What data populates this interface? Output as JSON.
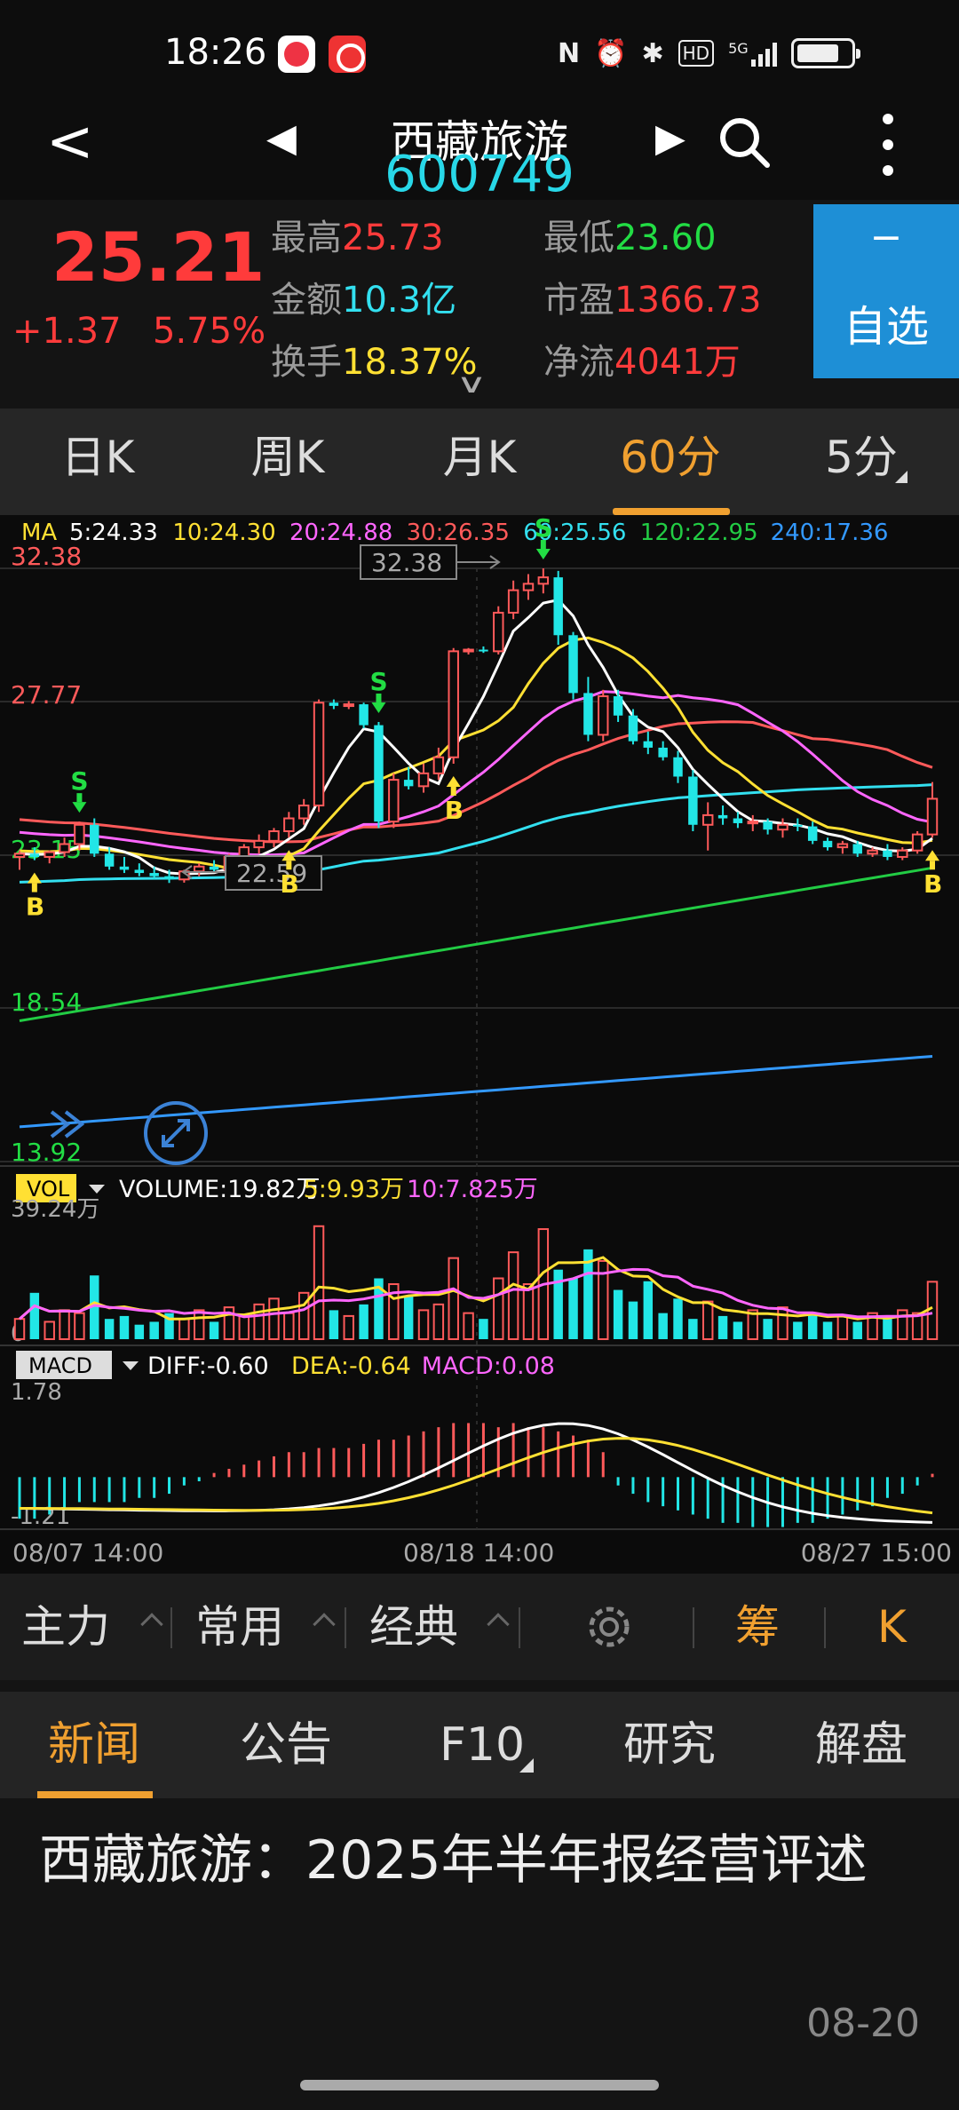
{
  "status": {
    "time": "18:26",
    "icons": [
      "nfc-icon",
      "alarm-icon",
      "bluetooth-icon",
      "hd-icon",
      "5g-signal-icon",
      "battery-icon"
    ],
    "hd_label": "HD",
    "network_label": "5G"
  },
  "header": {
    "stock_name": "西藏旅游",
    "stock_code": "600749"
  },
  "quote": {
    "price": "25.21",
    "change": "+1.37",
    "change_pct": "5.75%",
    "high_label": "最高",
    "high_value": "25.73",
    "low_label": "最低",
    "low_value": "23.60",
    "amount_label": "金额",
    "amount_value": "10.3亿",
    "pe_label": "市盈",
    "pe_value": "1366.73",
    "turnover_label": "换手",
    "turnover_value": "18.37%",
    "netflow_label": "净流",
    "netflow_value": "4041万",
    "fav_minus": "−",
    "fav_label": "自选"
  },
  "period_tabs": [
    "日K",
    "周K",
    "月K",
    "60分",
    "5分"
  ],
  "active_period": "60分",
  "chart": {
    "ma_label": "MA",
    "ma_values": [
      {
        "text": "5:24.33",
        "color": "#ffffff"
      },
      {
        "text": "10:24.30",
        "color": "#ffe033"
      },
      {
        "text": "20:24.88",
        "color": "#ff66ff"
      },
      {
        "text": "30:26.35",
        "color": "#ff5a5a"
      },
      {
        "text": "60:25.56",
        "color": "#33e0f0"
      },
      {
        "text": "120:22.95",
        "color": "#22cc44"
      },
      {
        "text": "240:17.36",
        "color": "#3399ff"
      }
    ],
    "y_labels": [
      "32.38",
      "27.77",
      "23.15",
      "18.54",
      "13.92"
    ],
    "high_annot": "32.38",
    "low_annot": "22.59",
    "vol_label": "VOL",
    "vol_values": [
      {
        "text": "VOLUME:19.82万",
        "color": "#ffffff"
      },
      {
        "text": "5:9.93万",
        "color": "#ffe033"
      },
      {
        "text": "10:7.825万",
        "color": "#ff66ff"
      }
    ],
    "vol_max": "39.24万",
    "vol_zero": "0",
    "macd_label": "MACD",
    "macd_values": [
      {
        "text": "DIFF:-0.60",
        "color": "#ffffff"
      },
      {
        "text": "DEA:-0.64",
        "color": "#ffe033"
      },
      {
        "text": "MACD:0.08",
        "color": "#ff66ff"
      }
    ],
    "macd_max": "1.78",
    "macd_min": "-1.21",
    "x_labels": [
      "08/07 14:00",
      "08/18 14:00",
      "08/27 15:00"
    ],
    "signal_b": "B",
    "signal_s": "S"
  },
  "chart_data": {
    "type": "candlestick",
    "price_axis_ticks": [
      32.38,
      27.77,
      23.15,
      18.54,
      13.92
    ],
    "price_range": [
      13.92,
      32.38
    ],
    "volume_range": [
      0,
      39.24
    ],
    "macd_range": [
      -1.21,
      1.78
    ],
    "x_ticks": [
      "08/07 14:00",
      "08/18 14:00",
      "08/27 15:00"
    ],
    "highest": 32.38,
    "lowest": 22.59,
    "last_close": 25.21,
    "candles_ohlc": [
      [
        23.4,
        23.6,
        23.0,
        23.5
      ],
      [
        23.5,
        23.7,
        23.3,
        23.4
      ],
      [
        23.4,
        23.6,
        23.2,
        23.55
      ],
      [
        23.55,
        24.0,
        23.4,
        23.8
      ],
      [
        23.8,
        24.5,
        23.6,
        24.4
      ],
      [
        24.4,
        24.6,
        23.4,
        23.5
      ],
      [
        23.5,
        23.7,
        23.0,
        23.1
      ],
      [
        23.1,
        23.4,
        22.9,
        23.0
      ],
      [
        23.0,
        23.2,
        22.8,
        22.9
      ],
      [
        22.9,
        23.1,
        22.7,
        22.8
      ],
      [
        22.8,
        23.0,
        22.59,
        22.7
      ],
      [
        22.7,
        23.0,
        22.6,
        22.95
      ],
      [
        22.95,
        23.2,
        22.8,
        23.1
      ],
      [
        23.1,
        23.3,
        22.9,
        23.0
      ],
      [
        23.0,
        23.5,
        22.9,
        23.4
      ],
      [
        23.4,
        23.8,
        23.2,
        23.7
      ],
      [
        23.7,
        24.1,
        23.5,
        23.9
      ],
      [
        23.9,
        24.3,
        23.7,
        24.2
      ],
      [
        24.2,
        24.8,
        24.0,
        24.6
      ],
      [
        24.6,
        25.2,
        24.4,
        25.0
      ],
      [
        25.0,
        28.3,
        24.8,
        28.2
      ],
      [
        28.2,
        28.3,
        28.0,
        28.1
      ],
      [
        28.1,
        28.25,
        28.0,
        28.15
      ],
      [
        28.15,
        28.2,
        27.4,
        27.5
      ],
      [
        27.5,
        27.6,
        24.3,
        24.5
      ],
      [
        24.5,
        26.0,
        24.3,
        25.8
      ],
      [
        25.8,
        26.2,
        25.5,
        25.6
      ],
      [
        25.6,
        26.3,
        25.4,
        26.0
      ],
      [
        26.0,
        26.8,
        25.8,
        26.5
      ],
      [
        26.5,
        29.9,
        26.3,
        29.8
      ],
      [
        29.8,
        29.9,
        29.7,
        29.85
      ],
      [
        29.85,
        29.95,
        29.75,
        29.8
      ],
      [
        29.8,
        31.2,
        29.7,
        31.0
      ],
      [
        31.0,
        32.0,
        30.8,
        31.7
      ],
      [
        31.7,
        32.2,
        31.4,
        31.9
      ],
      [
        31.9,
        32.38,
        31.6,
        32.1
      ],
      [
        32.1,
        32.3,
        30.0,
        30.3
      ],
      [
        30.3,
        30.4,
        28.3,
        28.5
      ],
      [
        28.5,
        29.0,
        27.0,
        27.2
      ],
      [
        27.2,
        28.6,
        27.0,
        28.4
      ],
      [
        28.4,
        28.6,
        27.6,
        27.8
      ],
      [
        27.8,
        28.0,
        26.9,
        27.0
      ],
      [
        27.0,
        27.3,
        26.6,
        26.8
      ],
      [
        26.8,
        27.0,
        26.4,
        26.5
      ],
      [
        26.5,
        26.7,
        25.7,
        25.9
      ],
      [
        25.9,
        26.1,
        24.2,
        24.4
      ],
      [
        24.4,
        25.1,
        23.6,
        24.7
      ],
      [
        24.7,
        25.0,
        24.4,
        24.6
      ],
      [
        24.6,
        24.8,
        24.3,
        24.45
      ],
      [
        24.45,
        24.7,
        24.2,
        24.5
      ],
      [
        24.5,
        24.6,
        24.1,
        24.25
      ],
      [
        24.25,
        24.6,
        24.0,
        24.4
      ],
      [
        24.4,
        24.6,
        24.2,
        24.35
      ],
      [
        24.35,
        24.5,
        23.8,
        23.9
      ],
      [
        23.9,
        24.0,
        23.6,
        23.7
      ],
      [
        23.7,
        23.9,
        23.5,
        23.8
      ],
      [
        23.8,
        23.9,
        23.4,
        23.5
      ],
      [
        23.5,
        23.7,
        23.4,
        23.6
      ],
      [
        23.6,
        23.8,
        23.3,
        23.4
      ],
      [
        23.4,
        23.7,
        23.3,
        23.6
      ],
      [
        23.6,
        24.2,
        23.5,
        24.1
      ],
      [
        24.1,
        25.73,
        24.0,
        25.21
      ]
    ],
    "volume_wan": [
      7,
      16,
      6,
      10,
      9,
      22,
      7,
      8,
      5,
      6,
      9,
      7,
      10,
      6,
      11,
      8,
      12,
      14,
      9,
      16,
      39,
      10,
      8,
      12,
      21,
      19,
      15,
      10,
      12,
      28,
      9,
      7,
      21,
      30,
      19,
      38,
      24,
      21,
      31,
      27,
      17,
      13,
      20,
      9,
      14,
      7,
      13,
      8,
      6,
      10,
      7,
      11,
      6,
      9,
      6,
      8,
      6,
      9,
      7,
      10,
      9,
      19.82
    ],
    "macd_bars": [
      -1.0,
      -1.0,
      -0.9,
      -0.8,
      -0.6,
      -0.6,
      -0.6,
      -0.6,
      -0.5,
      -0.5,
      -0.4,
      -0.2,
      -0.1,
      0.1,
      0.2,
      0.3,
      0.4,
      0.5,
      0.6,
      0.6,
      0.7,
      0.7,
      0.7,
      0.8,
      0.9,
      0.9,
      1.0,
      1.1,
      1.2,
      1.3,
      1.3,
      1.3,
      1.2,
      1.3,
      1.2,
      1.2,
      1.1,
      1.0,
      0.9,
      0.6,
      -0.2,
      -0.4,
      -0.6,
      -0.7,
      -0.8,
      -0.9,
      -1.0,
      -1.1,
      -1.1,
      -1.2,
      -1.2,
      -1.2,
      -1.1,
      -1.1,
      -1.0,
      -0.9,
      -0.8,
      -0.7,
      -0.5,
      -0.4,
      -0.2,
      0.08
    ]
  },
  "tools": {
    "item1": "主力",
    "item2": "常用",
    "item3": "经典",
    "item4": "筹",
    "item5": "K"
  },
  "news_tabs": [
    "新闻",
    "公告",
    "F10",
    "研究",
    "解盘"
  ],
  "news": {
    "title": "西藏旅游：2025年半年报经营评述",
    "date": "08-20"
  }
}
